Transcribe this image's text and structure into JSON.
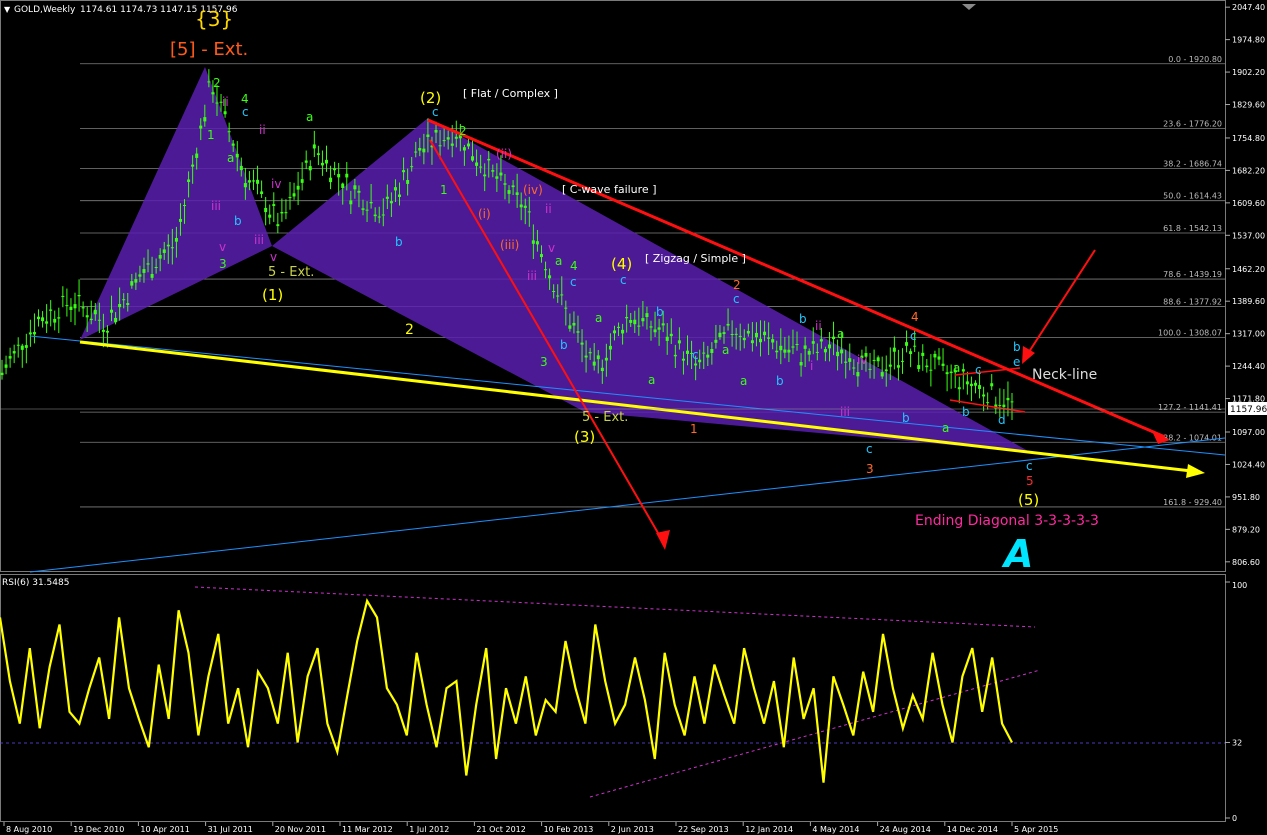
{
  "header": {
    "symbol": "GOLD,Weekly",
    "ohlc": "1174.61 1174.73 1147.15 1157.96"
  },
  "colors": {
    "background": "#000000",
    "candle": "#39ff14",
    "wave_fill": "#5b1fb0",
    "trend_red": "#ff1010",
    "trend_yellow": "#ffff00",
    "trend_blue": "#1e90ff",
    "fib": "#808080",
    "rsi_line": "#ffff00",
    "rsi_dash": "#cc33cc",
    "label_orange": "#ff5a1a",
    "label_pink": "#ff2aa0"
  },
  "chart_data": [
    {
      "type": "line",
      "name": "price",
      "axis_ticks": [
        "2047.40",
        "1974.80",
        "1902.20",
        "1829.60",
        "1754.80",
        "1682.20",
        "1609.60",
        "1537.00",
        "1462.20",
        "1389.60",
        "1317.00",
        "1244.40",
        "1171.80",
        "1097.00",
        "1024.40",
        "951.80",
        "879.20",
        "806.60"
      ],
      "current_price": "1157.96",
      "ylim": [
        795,
        2050
      ],
      "x": [
        "2010-08",
        "2010-10",
        "2010-12",
        "2011-02",
        "2011-04",
        "2011-06",
        "2011-08",
        "2011-10",
        "2011-12",
        "2012-02",
        "2012-04",
        "2012-06",
        "2012-08",
        "2012-10",
        "2012-12",
        "2013-02",
        "2013-04",
        "2013-06",
        "2013-08",
        "2013-10",
        "2013-12",
        "2014-02",
        "2014-04",
        "2014-06",
        "2014-08",
        "2014-10",
        "2014-12",
        "2015-02",
        "2015-04",
        "2015-06"
      ],
      "values": [
        1230,
        1345,
        1390,
        1340,
        1450,
        1520,
        1880,
        1670,
        1560,
        1730,
        1640,
        1590,
        1730,
        1770,
        1680,
        1600,
        1400,
        1230,
        1360,
        1320,
        1240,
        1330,
        1300,
        1270,
        1290,
        1230,
        1280,
        1230,
        1200,
        1158
      ],
      "fib_levels": [
        {
          "label": "0.0 - 1920.80",
          "price": 1920.8
        },
        {
          "label": "23.6 - 1776.20",
          "price": 1776.2
        },
        {
          "label": "38.2 - 1686.74",
          "price": 1686.74
        },
        {
          "label": "50.0 - 1614.43",
          "price": 1614.43
        },
        {
          "label": "61.8 - 1542.13",
          "price": 1542.13
        },
        {
          "label": "78.6 - 1439.19",
          "price": 1439.19
        },
        {
          "label": "88.6 - 1377.92",
          "price": 1377.92
        },
        {
          "label": "100.0 - 1308.07",
          "price": 1308.07
        },
        {
          "label": "127.2 - 1141.41",
          "price": 1141.41
        },
        {
          "label": "138.2 - 1074.01",
          "price": 1074.01
        },
        {
          "label": "161.8 - 929.40",
          "price": 929.4
        }
      ],
      "x_ticks": [
        "8 Aug 2010",
        "19 Dec 2010",
        "10 Apr 2011",
        "31 Jul 2011",
        "20 Nov 2011",
        "11 Mar 2012",
        "1 Jul 2012",
        "21 Oct 2012",
        "10 Feb 2013",
        "2 Jun 2013",
        "22 Sep 2013",
        "12 Jan 2014",
        "4 May 2014",
        "24 Aug 2014",
        "14 Dec 2014",
        "5 Apr 2015"
      ]
    },
    {
      "type": "line",
      "name": "RSI(6) 31.5485",
      "axis_ticks": [
        "100",
        "32",
        "0"
      ],
      "ylim": [
        0,
        100
      ],
      "values": [
        85,
        58,
        40,
        72,
        38,
        64,
        82,
        45,
        40,
        55,
        68,
        42,
        85,
        55,
        42,
        30,
        65,
        42,
        88,
        70,
        35,
        60,
        78,
        40,
        55,
        30,
        62,
        55,
        40,
        70,
        32,
        60,
        72,
        40,
        28,
        52,
        75,
        92,
        85,
        55,
        48,
        35,
        70,
        48,
        30,
        55,
        58,
        18,
        48,
        72,
        25,
        55,
        40,
        60,
        35,
        50,
        45,
        75,
        55,
        40,
        82,
        58,
        40,
        48,
        68,
        50,
        25,
        70,
        48,
        35,
        60,
        40,
        65,
        52,
        40,
        72,
        55,
        40,
        58,
        30,
        68,
        42,
        55,
        15,
        60,
        48,
        35,
        62,
        45,
        78,
        55,
        38,
        52,
        42,
        70,
        48,
        32,
        60,
        72,
        45,
        68,
        40,
        32
      ],
      "level": "32"
    }
  ],
  "annotations": {
    "big3": "{3}",
    "ext5": "[5] - Ext.",
    "w1": "(1)",
    "w2": "(2)",
    "w3": "(3)",
    "w4": "(4)",
    "w5": "(5)",
    "flat": "[ Flat / Complex ]",
    "cwave": "[ C-wave failure ]",
    "zigzag": "[ Zigzag / Simple ]",
    "neckline": "Neck-line",
    "ending": "Ending Diagonal 3-3-3-3-3",
    "ext_a": "5 - Ext.",
    "ext_b": "5 - Ext.",
    "num2": "2",
    "small": [
      {
        "t": "2",
        "c": "#39ff14"
      },
      {
        "t": "4",
        "c": "#39ff14"
      },
      {
        "t": "ii",
        "c": "#cc33cc"
      },
      {
        "t": "ii",
        "c": "#cc33cc"
      },
      {
        "t": "c",
        "c": "#1ec8ff"
      },
      {
        "t": "a",
        "c": "#39ff14"
      },
      {
        "t": "1",
        "c": "#39ff14"
      },
      {
        "t": "iii",
        "c": "#cc33cc"
      },
      {
        "t": "iv",
        "c": "#cc33cc"
      },
      {
        "t": "b",
        "c": "#1ec8ff"
      },
      {
        "t": "v",
        "c": "#cc33cc"
      },
      {
        "t": "3",
        "c": "#39ff14"
      },
      {
        "t": "iii",
        "c": "#cc33cc"
      },
      {
        "t": "v",
        "c": "#cc33cc"
      },
      {
        "t": "a",
        "c": "#39ff14"
      },
      {
        "t": "b",
        "c": "#1ec8ff"
      },
      {
        "t": "c",
        "c": "#1ec8ff"
      },
      {
        "t": "2",
        "c": "#39ff14"
      },
      {
        "t": "1",
        "c": "#39ff14"
      },
      {
        "t": "(ii)",
        "c": "#cc33cc"
      },
      {
        "t": "(i)",
        "c": "#ff6a2a"
      },
      {
        "t": "(iv)",
        "c": "#ff6a2a"
      },
      {
        "t": "ii",
        "c": "#cc33cc"
      },
      {
        "t": "(iii)",
        "c": "#ff6a2a"
      },
      {
        "t": "v",
        "c": "#cc33cc"
      },
      {
        "t": "a",
        "c": "#39ff14"
      },
      {
        "t": "iii",
        "c": "#cc33cc"
      },
      {
        "t": "4",
        "c": "#39ff14"
      },
      {
        "t": "c",
        "c": "#1ec8ff"
      },
      {
        "t": "b",
        "c": "#1ec8ff"
      },
      {
        "t": "3",
        "c": "#39ff14"
      },
      {
        "t": "a",
        "c": "#39ff14"
      },
      {
        "t": "c",
        "c": "#1ec8ff"
      },
      {
        "t": "b",
        "c": "#1ec8ff"
      },
      {
        "t": "a",
        "c": "#39ff14"
      },
      {
        "t": "c",
        "c": "#1ec8ff"
      },
      {
        "t": "a",
        "c": "#39ff14"
      },
      {
        "t": "2",
        "c": "#ff6a2a"
      },
      {
        "t": "c",
        "c": "#1ec8ff"
      },
      {
        "t": "a",
        "c": "#39ff14"
      },
      {
        "t": "b",
        "c": "#1ec8ff"
      },
      {
        "t": "1",
        "c": "#ff6a2a"
      },
      {
        "t": "b",
        "c": "#1ec8ff"
      },
      {
        "t": "ii",
        "c": "#cc33cc"
      },
      {
        "t": "i",
        "c": "#cc33cc"
      },
      {
        "t": "a",
        "c": "#39ff14"
      },
      {
        "t": "iv",
        "c": "#cc33cc"
      },
      {
        "t": "iii",
        "c": "#cc33cc"
      },
      {
        "t": "c",
        "c": "#1ec8ff"
      },
      {
        "t": "3",
        "c": "#ff6a2a"
      },
      {
        "t": "b",
        "c": "#1ec8ff"
      },
      {
        "t": "4",
        "c": "#ff6a2a"
      },
      {
        "t": "c",
        "c": "#1ec8ff"
      },
      {
        "t": "a",
        "c": "#39ff14"
      },
      {
        "t": "a",
        "c": "#39ff14"
      },
      {
        "t": "c",
        "c": "#1ec8ff"
      },
      {
        "t": "b",
        "c": "#1ec8ff"
      },
      {
        "t": "d",
        "c": "#1ec8ff"
      },
      {
        "t": "b",
        "c": "#1ec8ff"
      },
      {
        "t": "e",
        "c": "#1ec8ff"
      },
      {
        "t": "c",
        "c": "#1ec8ff"
      },
      {
        "t": "5",
        "c": "#ff2a2a"
      }
    ]
  }
}
